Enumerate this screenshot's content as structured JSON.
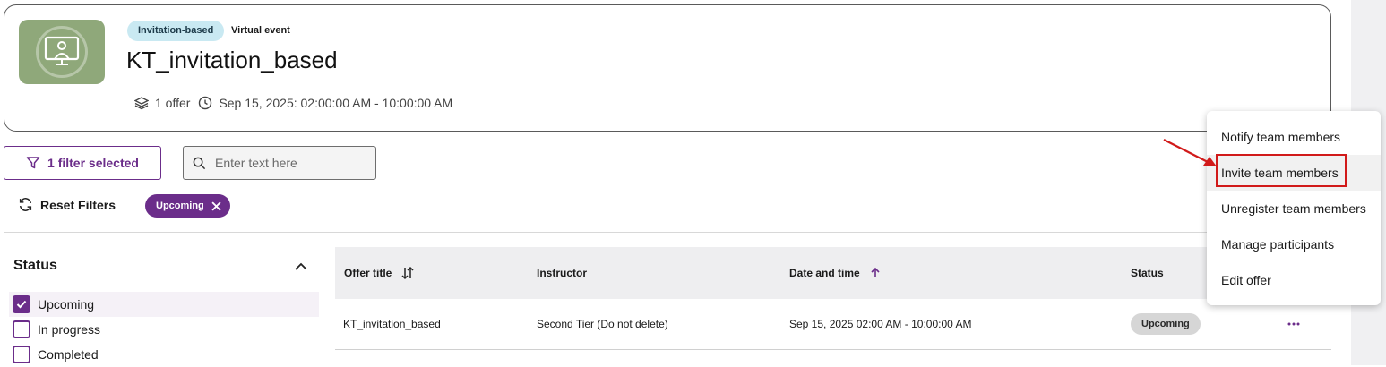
{
  "event": {
    "badge_type": "Invitation-based",
    "badge_format": "Virtual event",
    "title": "KT_invitation_based",
    "offers": "1 offer",
    "datetime": "Sep 15, 2025: 02:00:00 AM - 10:00:00 AM",
    "thumbnail_icon": "presenter-screen-icon"
  },
  "filters": {
    "filter_button_label": "1 filter selected",
    "search_placeholder": "Enter text here",
    "reset_label": "Reset Filters",
    "active_chip": "Upcoming"
  },
  "status_filter": {
    "heading": "Status",
    "options": [
      {
        "label": "Upcoming",
        "checked": true
      },
      {
        "label": "In progress",
        "checked": false
      },
      {
        "label": "Completed",
        "checked": false
      }
    ]
  },
  "table": {
    "columns": [
      "Offer title",
      "Instructor",
      "Date and time",
      "Status"
    ],
    "rows": [
      {
        "title": "KT_invitation_based",
        "instructor": "Second Tier (Do not delete)",
        "datetime": "Sep 15, 2025 02:00 AM - 10:00:00 AM",
        "status": "Upcoming"
      }
    ]
  },
  "menu": {
    "items": [
      "Notify team members",
      "Invite team members",
      "Unregister team members",
      "Manage participants",
      "Edit offer"
    ],
    "highlighted": "Invite team members"
  },
  "colors": {
    "accent": "#6b2d8a",
    "badge_bg": "#c9e9f2",
    "annotation": "#d11a1a",
    "thumbnail": "#8fa87a"
  }
}
